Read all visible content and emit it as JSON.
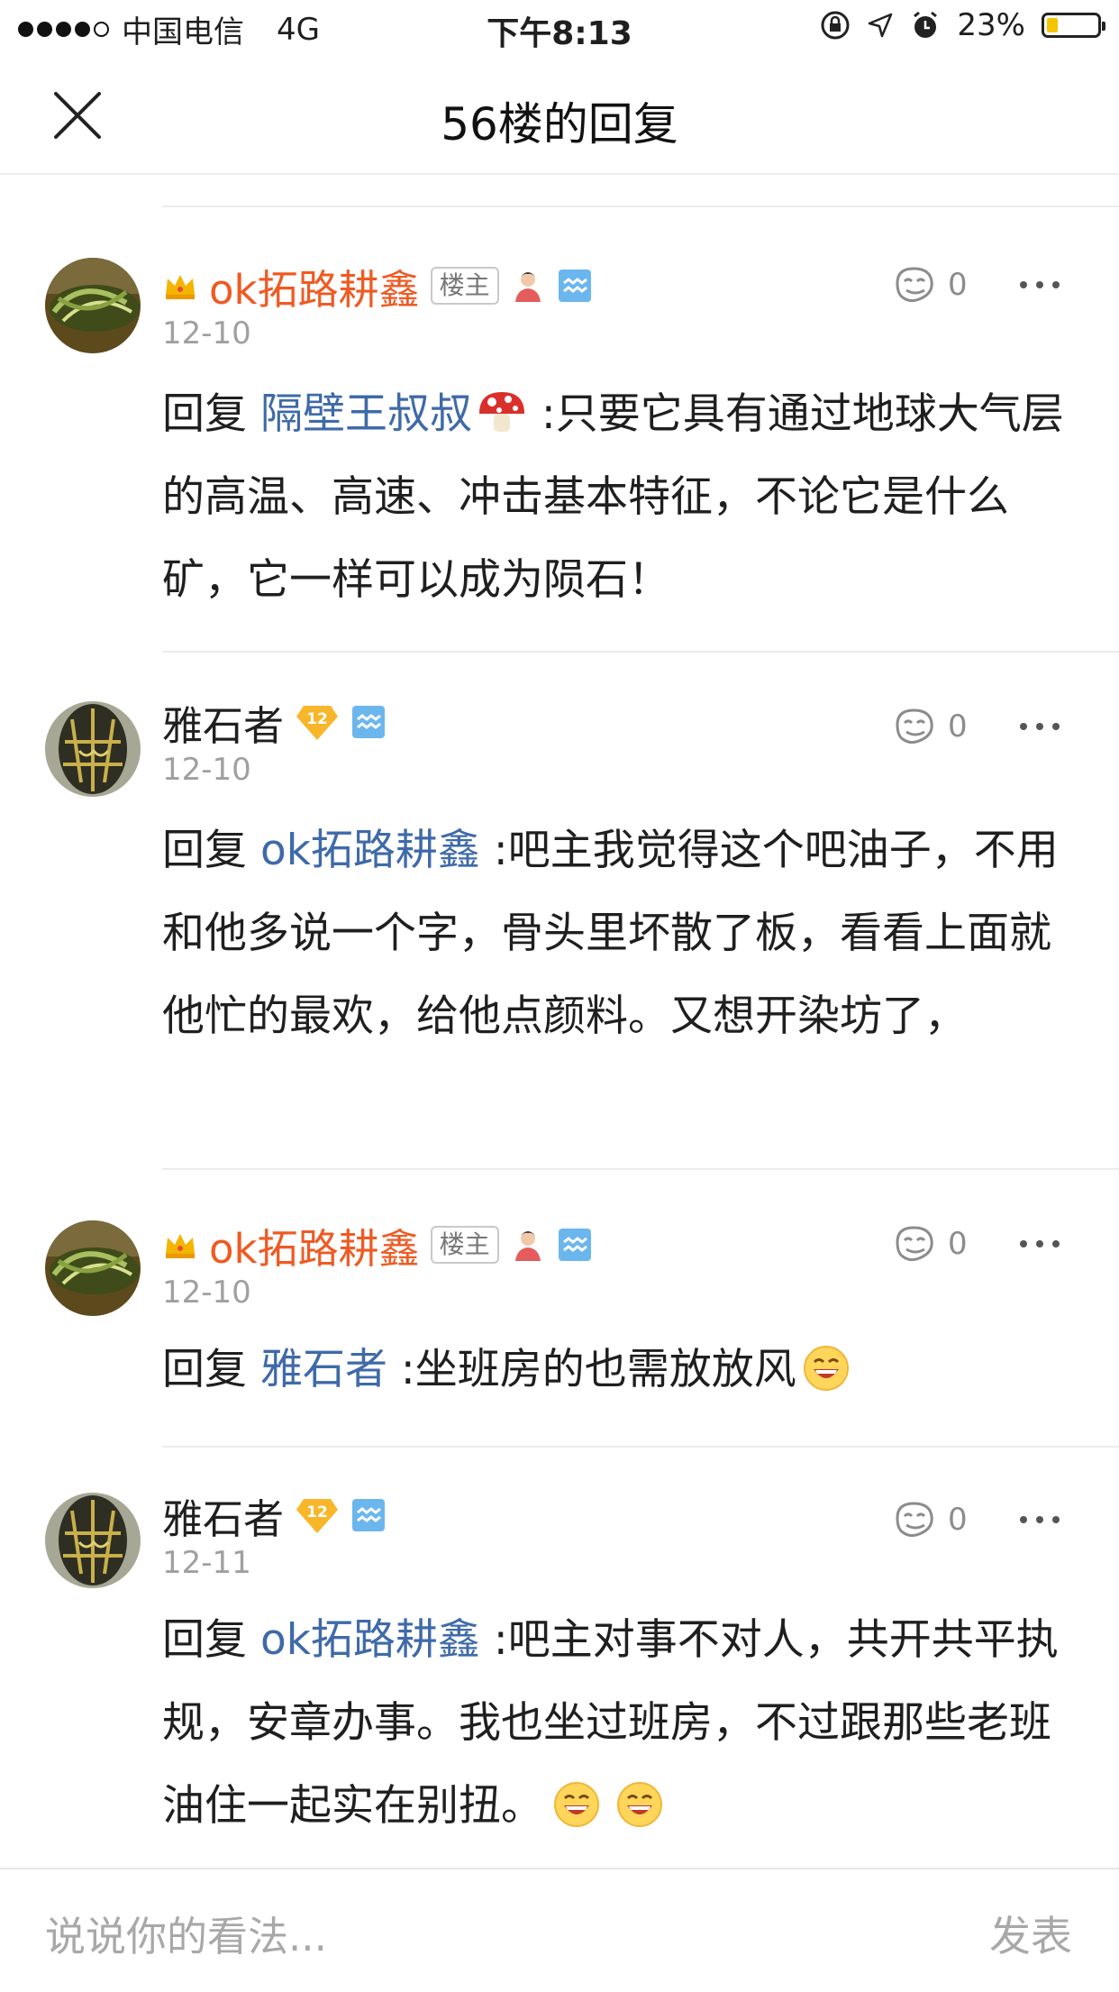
{
  "status_bar": {
    "carrier": "中国电信",
    "network": "4G",
    "time": "下午8:13",
    "battery": "23%",
    "battery_level": 0.23
  },
  "nav": {
    "title": "56楼的回复"
  },
  "comments": [
    {
      "name": "ok拓路耕鑫",
      "host_badge": "楼主",
      "date": "12-10",
      "likes": "0",
      "reply_prefix": "回复",
      "mention": "隔壁王叔叔",
      "text": " :只要它具有通过地球大气层的高温、高速、冲击基本特征，不论它是什么矿，它一样可以成为陨石！"
    },
    {
      "name": "雅石者",
      "level": "12",
      "date": "12-10",
      "likes": "0",
      "reply_prefix": "回复",
      "mention": "ok拓路耕鑫",
      "text": " :吧主我觉得这个吧油子，不用和他多说一个字，骨头里坏散了板，看看上面就他忙的最欢，给他点颜料。又想开染坊了，"
    },
    {
      "name": "ok拓路耕鑫",
      "host_badge": "楼主",
      "date": "12-10",
      "likes": "0",
      "reply_prefix": "回复",
      "mention": "雅石者",
      "text": " :坐班房的也需放放风"
    },
    {
      "name": "雅石者",
      "level": "12",
      "date": "12-11",
      "likes": "0",
      "reply_prefix": "回复",
      "mention": "ok拓路耕鑫",
      "text": " :吧主对事不对人，共开共平执规，安章办事。我也坐过班房，不过跟那些老班油住一起实在别扭。"
    }
  ],
  "input": {
    "placeholder": "说说你的看法...",
    "send_label": "发表"
  },
  "colors": {
    "host_name": "#ef5a23",
    "mention": "#3f6aa8",
    "muted": "#a0a0a0"
  }
}
